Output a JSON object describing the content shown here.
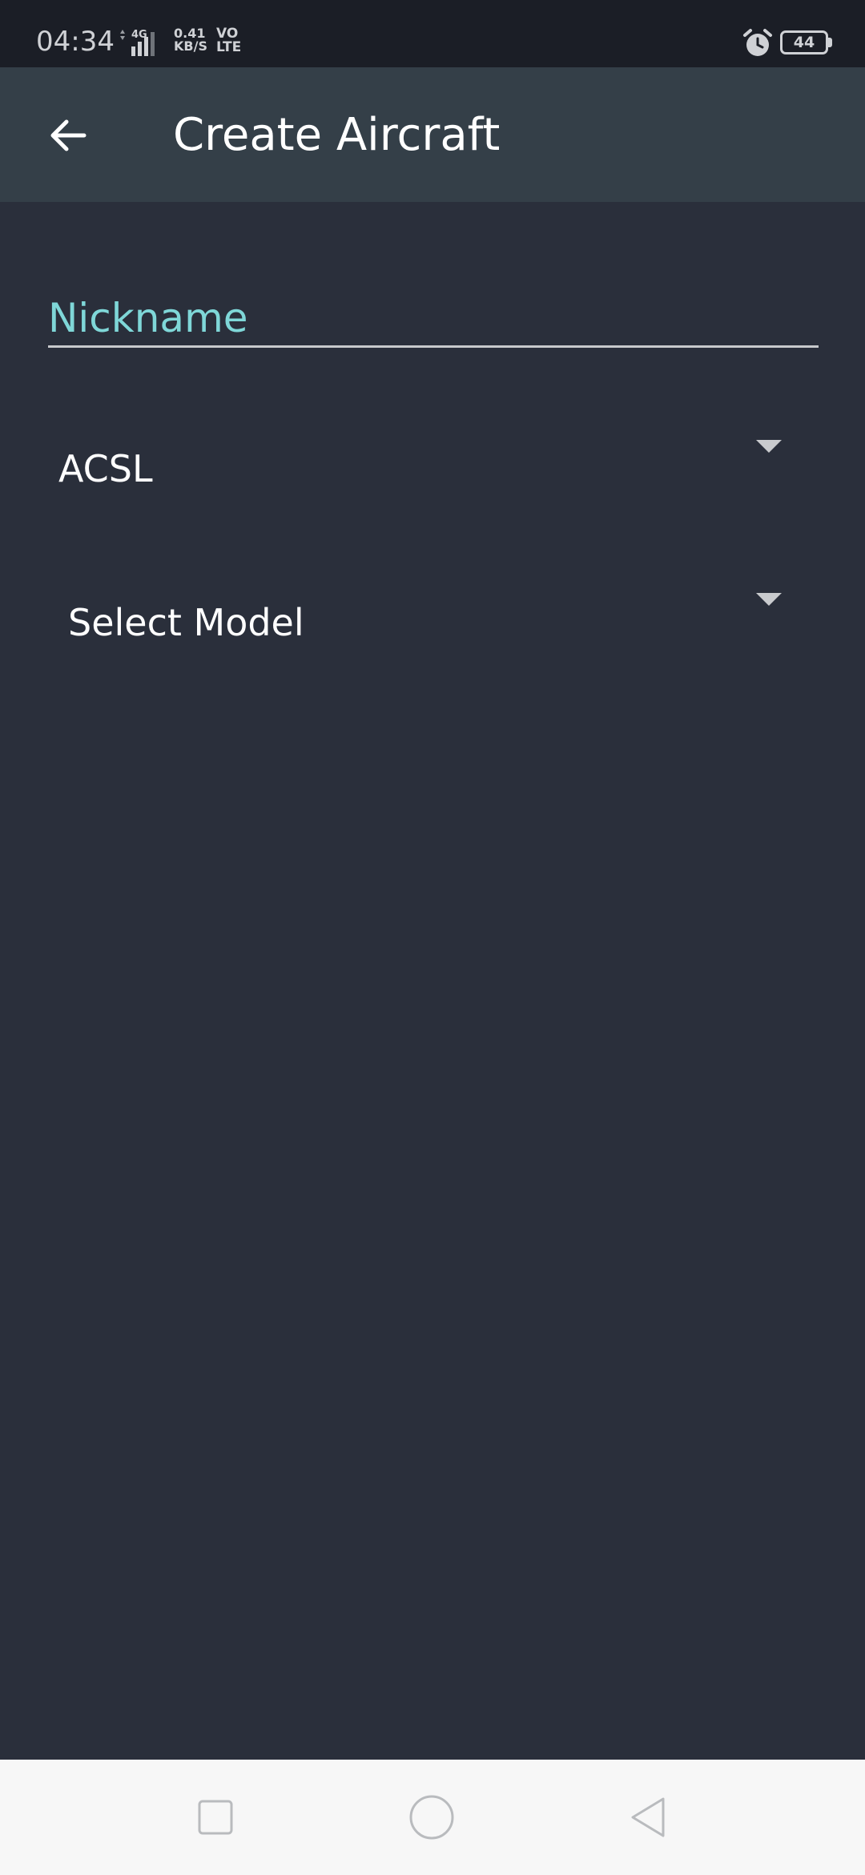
{
  "status_bar": {
    "time": "04:34",
    "network_type": "4G",
    "speed_value": "0.41",
    "speed_unit": "KB/S",
    "volte_top": "VO",
    "volte_bottom": "LTE",
    "battery_level": "44"
  },
  "app_bar": {
    "title": "Create Aircraft",
    "back_icon": "arrow-left-icon"
  },
  "form": {
    "nickname_placeholder": "Nickname",
    "nickname_value": "",
    "manufacturer_selected": "ACSL",
    "model_selected": "Select Model"
  },
  "nav_bar": {
    "recents_icon": "square-icon",
    "home_icon": "circle-icon",
    "back_icon": "triangle-back-icon"
  },
  "colors": {
    "background": "#2a2f3b",
    "app_bar": "#343f48",
    "status_bar": "#1b1e26",
    "accent": "#7fd7d8",
    "nav_bar": "#f7f7f7"
  }
}
